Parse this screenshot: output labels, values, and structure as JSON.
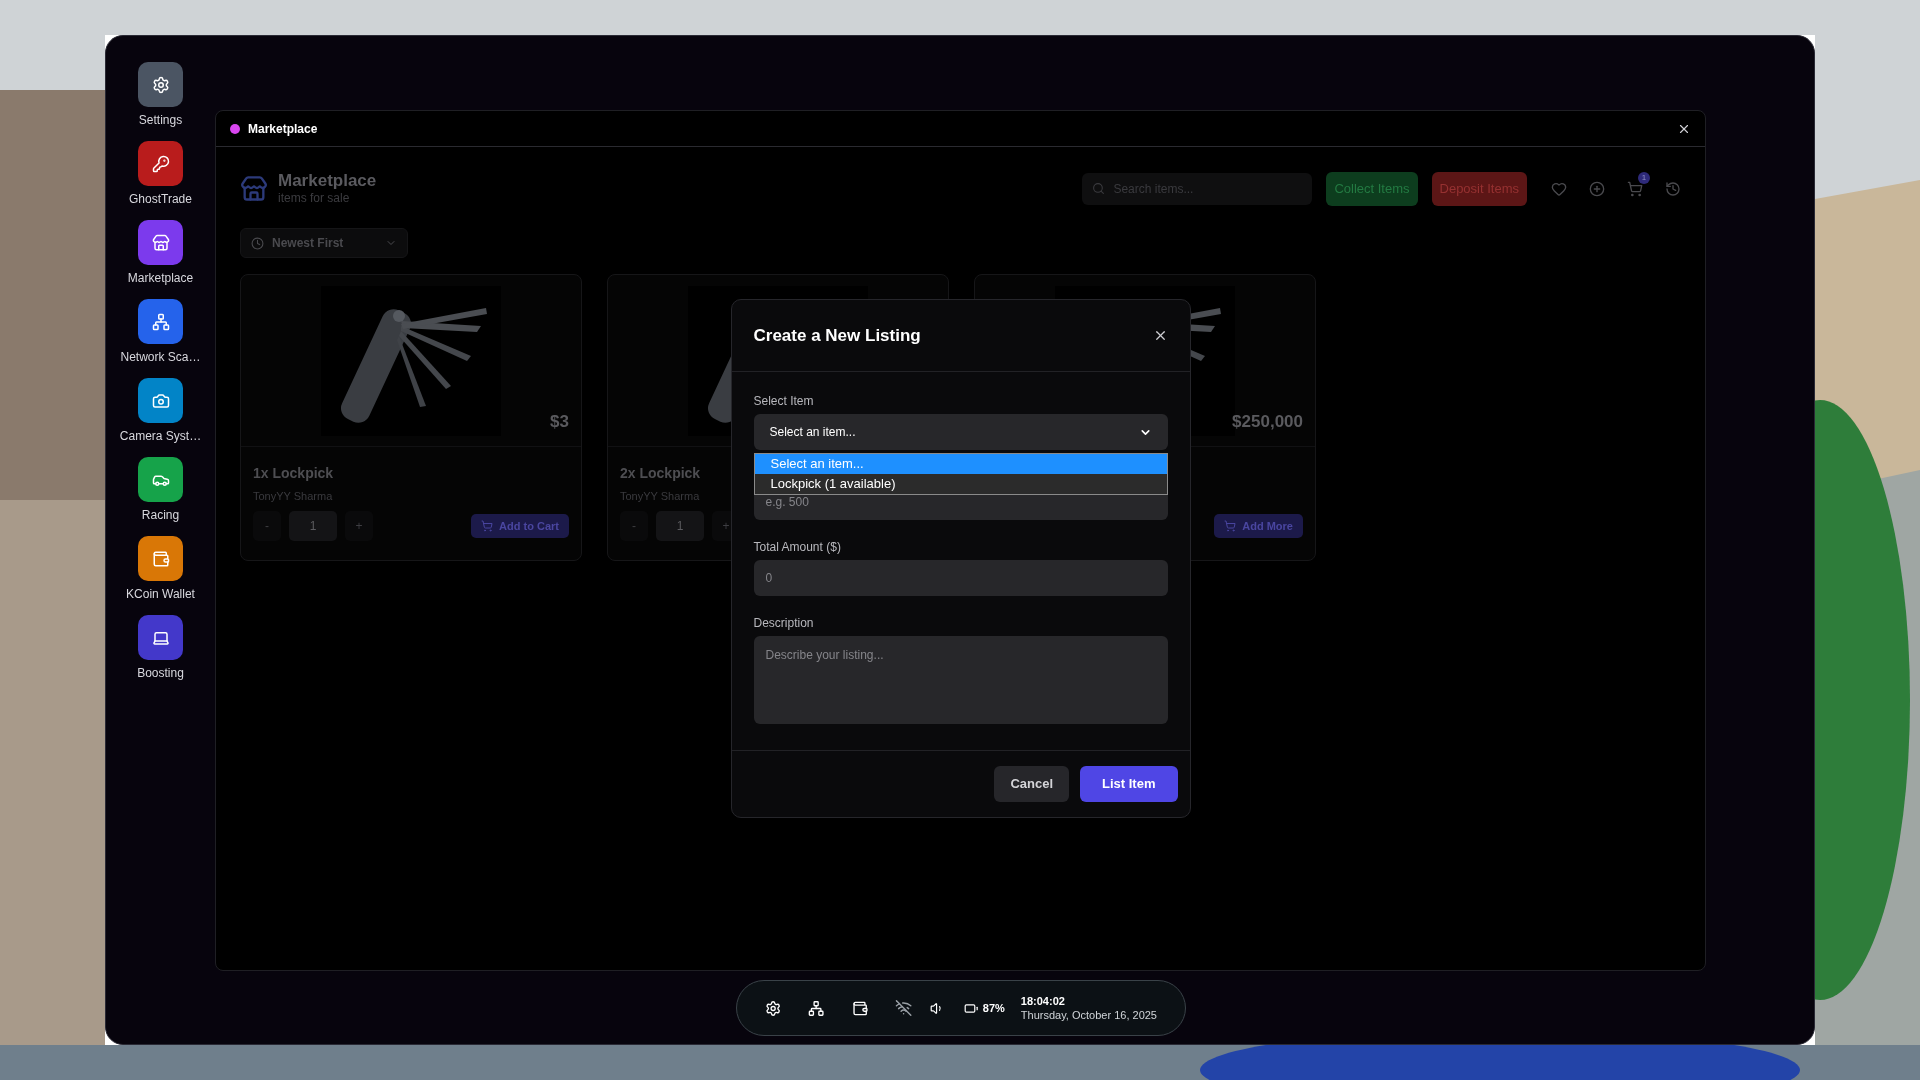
{
  "desktop_apps": [
    {
      "label": "Settings",
      "color": "#4b5563"
    },
    {
      "label": "GhostTrade",
      "color": "#b91c1c"
    },
    {
      "label": "Marketplace",
      "color": "#7c3aed"
    },
    {
      "label": "Network Sca…",
      "color": "#2563eb"
    },
    {
      "label": "Camera Syst…",
      "color": "#0284c7"
    },
    {
      "label": "Racing",
      "color": "#16a34a"
    },
    {
      "label": "KCoin Wallet",
      "color": "#d97706"
    },
    {
      "label": "Boosting",
      "color": "#4338ca"
    }
  ],
  "window": {
    "title": "Marketplace"
  },
  "marketplace": {
    "title": "Marketplace",
    "subtitle": "items for sale",
    "search": {
      "placeholder": "Search items..."
    },
    "buttons": [
      {
        "label": "Collect Items",
        "kind": "collect"
      },
      {
        "label": "Deposit Items",
        "kind": "deposit"
      }
    ],
    "cart_count": "1",
    "sort": {
      "value": "Newest First"
    },
    "cards": [
      {
        "price": "$3",
        "title": "1x Lockpick",
        "seller": "TonyYY Sharma",
        "decrement": "-",
        "quantity": "1",
        "increment": "+",
        "button": "Add to Cart"
      },
      {
        "title": "2x Lockpick",
        "seller": "TonyYY Sharma",
        "decrement": "-",
        "quantity": "1",
        "increment": "+"
      },
      {
        "price": "$250,000",
        "button": "Add More"
      }
    ]
  },
  "dialog": {
    "title": "Create a New Listing",
    "fields": [
      {
        "kind": "select",
        "label": "Select Item",
        "value": "Select an item...",
        "expanded": true,
        "options": [
          {
            "label": "Select an item...",
            "selected": true
          },
          {
            "label": "Lockpick (1 available)",
            "selected": false
          }
        ]
      },
      {
        "kind": "input",
        "placeholder": "e.g. 500"
      },
      {
        "kind": "input",
        "label": "Total Amount ($)",
        "placeholder": "0"
      },
      {
        "kind": "textarea",
        "label": "Description",
        "placeholder": "Describe your listing..."
      }
    ],
    "buttons": [
      {
        "label": "Cancel",
        "kind": "secondary"
      },
      {
        "label": "List Item",
        "kind": "primary"
      }
    ]
  },
  "taskbar": {
    "battery": "87%",
    "time": "18:04:02",
    "date": "Thursday, October 16, 2025"
  }
}
